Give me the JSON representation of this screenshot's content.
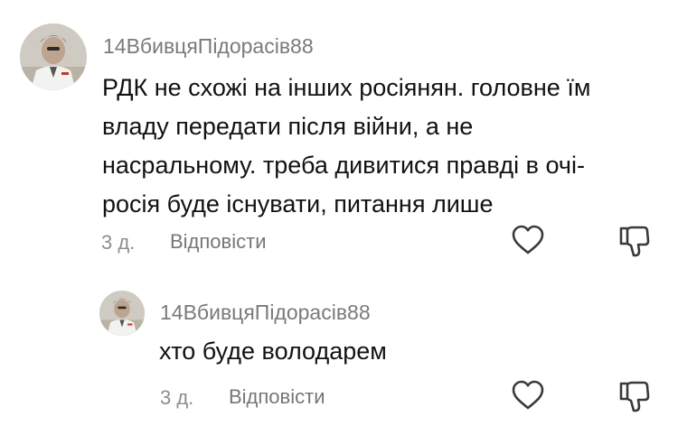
{
  "comments": [
    {
      "username": "14ВбивцяПідорасів88",
      "text_lines": [
        "РДК не схожі на інших росіянян. головне їм",
        "владу передати після війни, а не",
        "насральному. треба дивитися правді в очі-",
        "росія буде існувати, питання лише"
      ],
      "time": "3 д.",
      "reply_label": "Відповісти"
    },
    {
      "username": "14ВбивцяПідорасів88",
      "text_lines": [
        "хто буде володарем"
      ],
      "time": "3 д.",
      "reply_label": "Відповісти"
    }
  ],
  "icons": {
    "like": "heart-outline-icon",
    "dislike": "thumbs-down-outline-icon"
  }
}
